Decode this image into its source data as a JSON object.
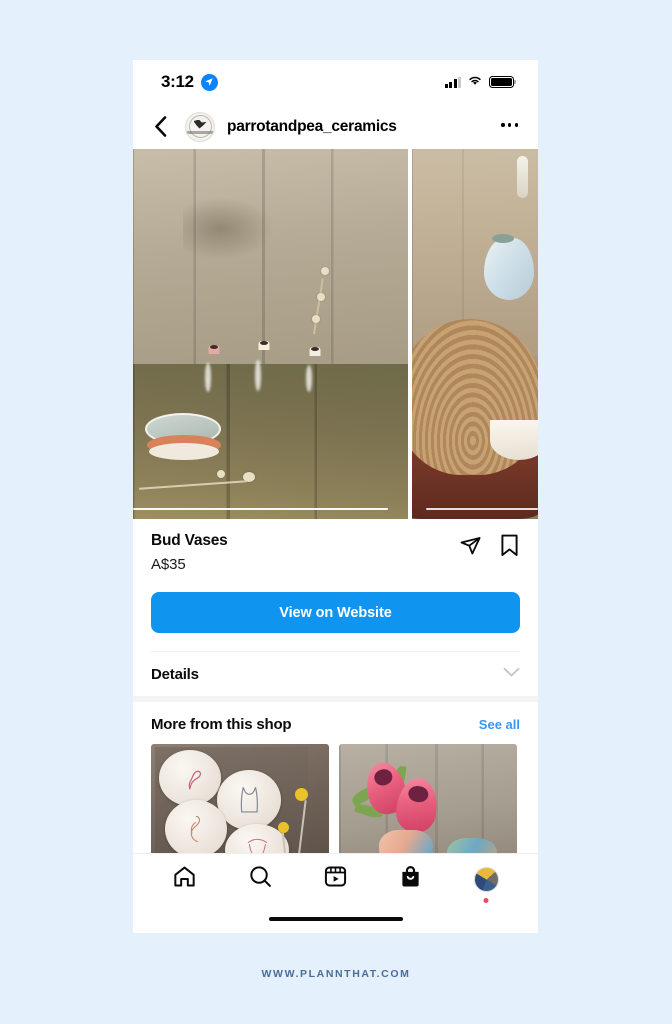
{
  "page": {
    "background_color": "#e4f0fc",
    "footer_text": "WWW.PLANNTHAT.COM",
    "footer_color": "#4a6d99"
  },
  "status_bar": {
    "time": "3:12",
    "location_icon": "location-arrow-icon",
    "signal_icon": "cellular-signal-icon",
    "signal_bars_filled": 3,
    "signal_bars_total": 4,
    "wifi_icon": "wifi-icon",
    "battery_icon": "battery-full-icon"
  },
  "app_bar": {
    "back_icon": "chevron-left-icon",
    "avatar_icon": "shop-avatar-icon",
    "shop_handle": "parrotandpea_ceramics",
    "more_icon": "ellipsis-icon"
  },
  "carousel": {
    "slides": [
      {
        "alt": "Four ceramic bud vases and a stacked dish on weathered timber"
      },
      {
        "alt": "Pale blue bud vase on a timber slice with a bowl"
      }
    ],
    "indicator_visible": true
  },
  "product": {
    "title": "Bud Vases",
    "price": "A$35",
    "share_icon": "share-paper-plane-icon",
    "save_icon": "bookmark-icon",
    "cta_label": "View on Website",
    "cta_color": "#0f94f0"
  },
  "details": {
    "title": "Details",
    "chevron_icon": "chevron-down-icon",
    "expanded": false
  },
  "more_from_shop": {
    "title": "More from this shop",
    "see_all_label": "See all",
    "see_all_color": "#3897f0",
    "items": [
      {
        "alt": "Four ceramic plates with line-art drawings and yellow billy buttons"
      },
      {
        "alt": "Pink protea flowers in painted ceramic vases"
      }
    ]
  },
  "tab_bar": {
    "tabs": [
      {
        "name": "home",
        "icon": "home-icon",
        "active": false
      },
      {
        "name": "search",
        "icon": "search-icon",
        "active": false
      },
      {
        "name": "reels",
        "icon": "reels-icon",
        "active": false
      },
      {
        "name": "shop",
        "icon": "shopping-bag-icon",
        "active": true
      },
      {
        "name": "profile",
        "icon": "profile-avatar-icon",
        "active": false,
        "badge": true
      }
    ],
    "home_indicator": true
  }
}
